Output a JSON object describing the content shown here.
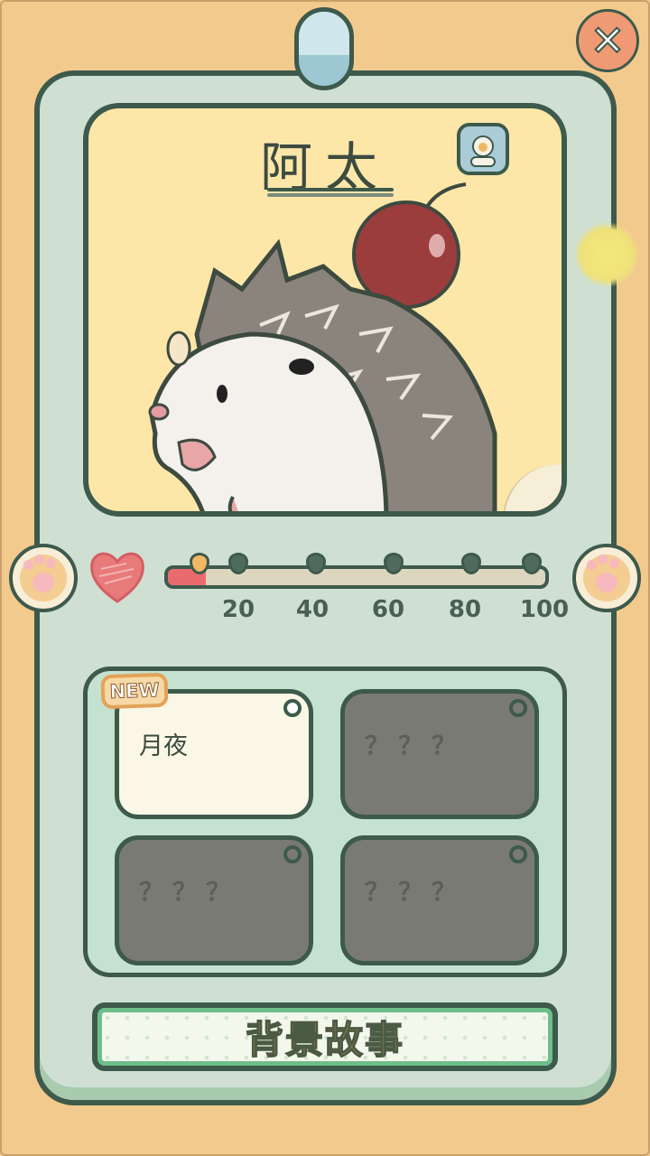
{
  "character": {
    "name": "阿太"
  },
  "affection": {
    "progress_fraction": 0.1,
    "milestones": [
      "20",
      "40",
      "60",
      "80",
      "100"
    ]
  },
  "stories": [
    {
      "title": "月夜",
      "locked": false,
      "is_new": true
    },
    {
      "title": "？？？",
      "locked": true
    },
    {
      "title": "？？？",
      "locked": true
    },
    {
      "title": "？？？",
      "locked": true
    }
  ],
  "badges": {
    "new_label": "NEW"
  },
  "buttons": {
    "close_label": "✕",
    "background_story_label": "背景故事"
  },
  "icons": [
    "close-icon",
    "pin-icon",
    "heart-icon",
    "paw-left-icon",
    "paw-right-icon",
    "character-badge-icon"
  ],
  "colors": {
    "background": "#f3ca8d",
    "card": "#cfe0d3",
    "outline": "#3d5a4c",
    "portrait_bg": "#fde7a8",
    "heart": "#e96b6e",
    "locked_card": "#7a7a74"
  }
}
